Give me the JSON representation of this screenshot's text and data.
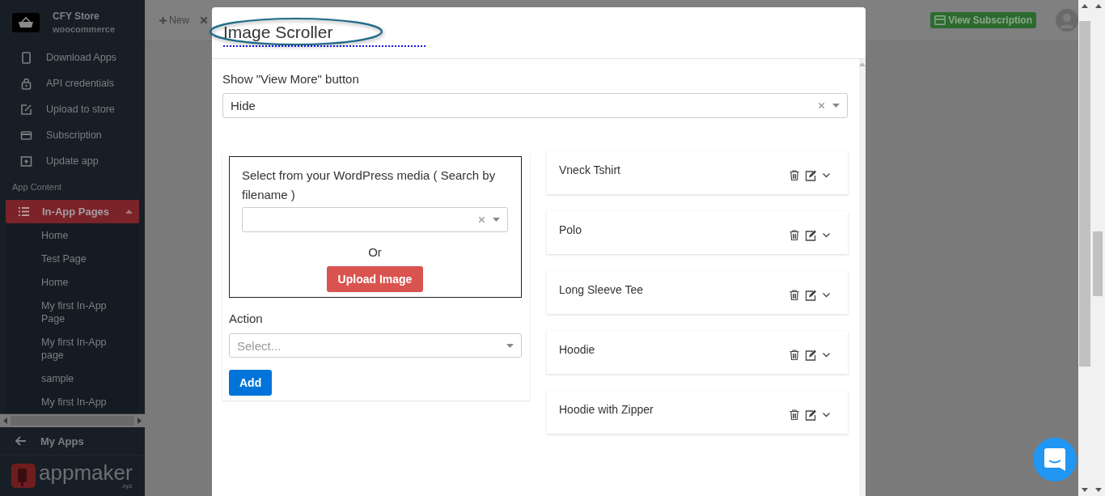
{
  "sidebar": {
    "store": {
      "name": "CFY Store",
      "platform": "woocommerce"
    },
    "nav_items": [
      {
        "kind": "phone",
        "label": "Download Apps",
        "selected": false
      },
      {
        "kind": "lock",
        "label": "API credentials",
        "selected": false
      },
      {
        "kind": "upload",
        "label": "Upload to store",
        "selected": false
      },
      {
        "kind": "card",
        "label": "Subscription",
        "selected": false
      },
      {
        "kind": "update",
        "label": "Update app",
        "selected": false
      }
    ],
    "section_label": "App Content",
    "pages_menu": {
      "label": "In-App Pages",
      "selected": true,
      "expanded": true,
      "children": [
        {
          "label": "Home"
        },
        {
          "label": "Test Page"
        },
        {
          "label": "Home"
        },
        {
          "label": "My first In-App Page"
        },
        {
          "label": "My first In-App page"
        },
        {
          "label": "sample"
        },
        {
          "label": "My first In-App"
        }
      ]
    },
    "back_link": "My Apps",
    "brand": {
      "name": "appmaker",
      "suffix": ".xyz"
    }
  },
  "topbar": {
    "new_button": "New",
    "subscription_button": "View Subscription"
  },
  "modal": {
    "title": "Image Scroller",
    "view_more": {
      "label": "Show \"View More\" button",
      "value": "Hide"
    },
    "media": {
      "label": "Select from your WordPress media ( Search by filename )",
      "or": "Or",
      "upload_button": "Upload Image"
    },
    "action": {
      "label": "Action",
      "placeholder": "Select..."
    },
    "add_button": "Add",
    "items": [
      {
        "title": "Vneck Tshirt"
      },
      {
        "title": "Polo"
      },
      {
        "title": "Long Sleeve Tee"
      },
      {
        "title": "Hoodie"
      },
      {
        "title": "Hoodie with Zipper"
      }
    ]
  }
}
